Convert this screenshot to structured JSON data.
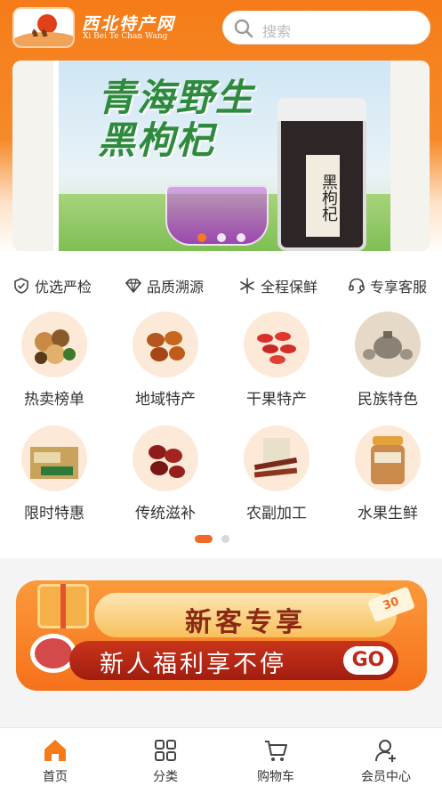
{
  "header": {
    "brand_cn": "西北特产网",
    "brand_en": "Xi Bei Te Chan Wang",
    "search_placeholder": "搜索"
  },
  "banner": {
    "title_line1": "青海野生",
    "title_line2": "黑枸杞",
    "jar_label": "黑枸杞",
    "slides": 3,
    "active_slide": 1
  },
  "features": [
    "优选严检",
    "品质溯源",
    "全程保鲜",
    "专享客服"
  ],
  "categories": [
    {
      "label": "热卖榜单",
      "icon": "mixed-nuts-image"
    },
    {
      "label": "地域特产",
      "icon": "dates-image"
    },
    {
      "label": "干果特产",
      "icon": "goji-berries-image"
    },
    {
      "label": "民族特色",
      "icon": "silver-teapot-image"
    },
    {
      "label": "限时特惠",
      "icon": "milk-candy-box-image"
    },
    {
      "label": "传统滋补",
      "icon": "red-dates-image"
    },
    {
      "label": "农副加工",
      "icon": "beef-jerky-image"
    },
    {
      "label": "水果生鲜",
      "icon": "almond-jar-image"
    }
  ],
  "pager": {
    "pages": 2,
    "active": 1
  },
  "promo": {
    "headline": "新客专享",
    "subline": "新人福利享不停",
    "button": "GO",
    "coupon": "30"
  },
  "tabbar": [
    {
      "label": "首页",
      "icon": "home-icon",
      "active": true
    },
    {
      "label": "分类",
      "icon": "grid-icon",
      "active": false
    },
    {
      "label": "购物车",
      "icon": "cart-icon",
      "active": false
    },
    {
      "label": "会员中心",
      "icon": "user-icon",
      "active": false
    }
  ],
  "colors": {
    "accent": "#f57c18",
    "active_dot": "#ef6a24"
  }
}
